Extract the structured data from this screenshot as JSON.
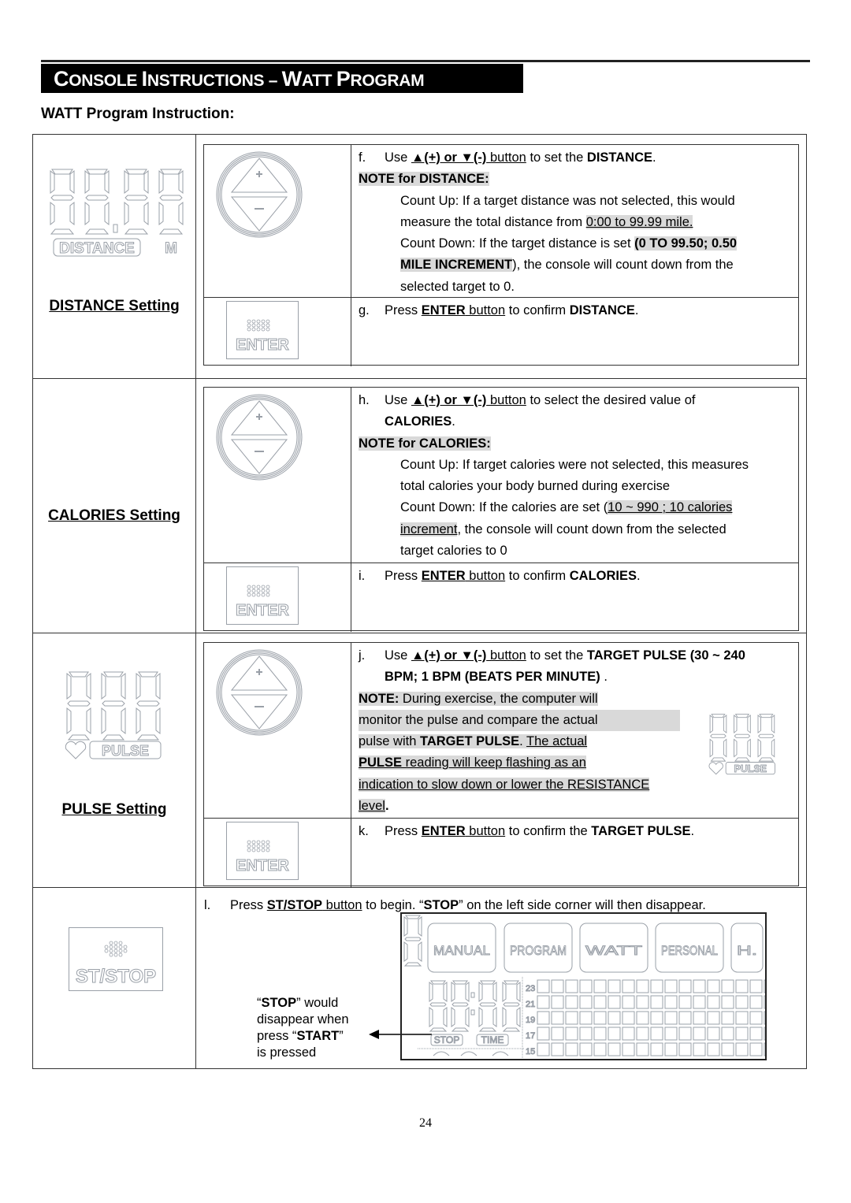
{
  "header": {
    "banner_title_parts": [
      "C",
      "ONSOLE ",
      "I",
      "NSTRUCTIONS – ",
      "W",
      "ATT ",
      "P",
      "ROGRAM"
    ],
    "subtitle": "WATT Program Instruction:"
  },
  "sections": {
    "distance": {
      "setting_label": "DISTANCE Setting",
      "lcd_label": "DISTANCE",
      "lcd_unit": "M",
      "step_f": {
        "letter": "f.",
        "pre": "Use ",
        "btn": "▲(+) or ▼(-)",
        "btn_word": " button",
        "mid": " to set the ",
        "target": "DISTANCE",
        "end": "."
      },
      "note_title": "NOTE for DISTANCE:",
      "count_up_1": "Count Up: If a target distance was not selected, this would",
      "count_up_2_pre": "measure the total distance from ",
      "count_up_2_range": "0:00 to 99.99 mile.",
      "count_down_1_pre": "Count Down: If the target distance is set ",
      "count_down_1_bold": "(0 TO 99.50; 0.50",
      "count_down_2_bold": "MILE INCREMENT",
      "count_down_2_rest": "), the console will count down from the",
      "count_down_3": "selected target to 0.",
      "step_g": {
        "letter": "g.",
        "pre": "Press ",
        "btn": "ENTER",
        "btn_word": " button",
        "mid": " to confirm ",
        "target": "DISTANCE",
        "end": "."
      },
      "enter_label": "ENTER"
    },
    "calories": {
      "setting_label": "CALORIES Setting",
      "step_h": {
        "letter": "h.",
        "pre": "Use ",
        "btn": "▲(+) or ▼(-)",
        "btn_word": " button",
        "mid": " to select the desired value of",
        "target": "CALORIES",
        "end": "."
      },
      "note_title": "NOTE for CALORIES:",
      "count_up_1": "Count Up: If target calories were not selected, this measures",
      "count_up_2": "total calories your body burned during exercise",
      "count_down_1_pre": "Count Down: If the calories are set (",
      "count_down_1_range": "10 ~ 990 ; 10 calories ",
      "count_down_2_range": "increment",
      "count_down_2_rest": ", the console will count down from the selected",
      "count_down_3": "target calories to 0",
      "step_i": {
        "letter": "i.",
        "pre": "Press ",
        "btn": "ENTER",
        "btn_word": " button",
        "mid": " to confirm ",
        "target": "CALORIES",
        "end": "."
      },
      "enter_label": "ENTER"
    },
    "pulse": {
      "setting_label": "PULSE Setting",
      "lcd_label": "PULSE",
      "step_j": {
        "letter": "j.",
        "pre": "Use ",
        "btn": "▲(+) or ▼(-)",
        "btn_word": " button",
        "mid": " to set the ",
        "target": "TARGET PULSE (30 ~ 240",
        "target_2": "BPM; 1 BPM (BEATS PER MINUTE)",
        "end": " ."
      },
      "note_label": "NOTE:",
      "note_1": " During exercise, the computer will ",
      "note_2": "monitor the pulse and compare the actual",
      "note_3_pre": "pulse with ",
      "note_3_bold": "TARGET PULSE",
      "note_3_mid": ". ",
      "note_3_u": "The actual",
      "note_4_bold": "PULSE",
      "note_4_rest": " reading will keep flashing as an ",
      "note_5": "indication to slow down or lower the RESISTANCE",
      "note_6": "level",
      "note_6_end": ".",
      "step_k": {
        "letter": "k.",
        "pre": "Press ",
        "btn": "ENTER",
        "btn_word": " button",
        "mid": " to confirm the ",
        "target": "TARGET PULSE",
        "end": "."
      },
      "enter_label": "ENTER"
    },
    "start": {
      "btn_label": "ST/STOP",
      "step_l": {
        "letter": "l.",
        "pre": "Press ",
        "btn": "ST/STOP",
        "btn_word": " button",
        "mid": " to begin. “",
        "bold2": "STOP",
        "end": "” on the left side corner will then disappear."
      },
      "callout_1_q": "“",
      "callout_1_bold": "STOP",
      "callout_1_rest": "” would",
      "callout_2": "disappear when",
      "callout_3_pre": "press “",
      "callout_3_bold": "START",
      "callout_3_end": "”",
      "callout_4": "is pressed",
      "console": {
        "program_tabs": [
          "MANUAL",
          "PROGRAM",
          "WATT",
          "PERSONAL",
          "H."
        ],
        "time_display": "88:88",
        "stop_label": "STOP",
        "time_label": "TIME",
        "grid_row_labels": [
          "23",
          "21",
          "19",
          "17",
          "15"
        ]
      }
    }
  },
  "footer": {
    "page_number": "24"
  },
  "colors": {
    "banner_bg": "#000000",
    "highlight": "#d9d9d9",
    "lcd_outline": "#9aa0a8"
  }
}
